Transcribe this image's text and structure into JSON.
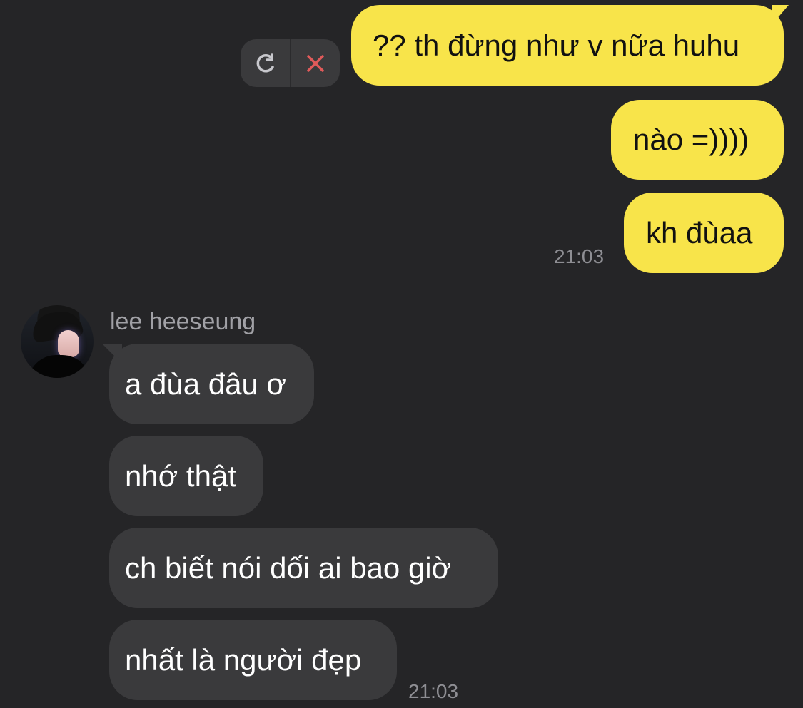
{
  "conversation": {
    "outgoing_messages": [
      {
        "text": "?? th đừng như v nữa huhu"
      },
      {
        "text": "nào =))))"
      },
      {
        "text": "kh đùaa"
      }
    ],
    "outgoing_timestamp": "21:03",
    "contact_name": "lee heeseung",
    "incoming_messages": [
      {
        "text": "a đùa đâu ơ"
      },
      {
        "text": "nhớ thật"
      },
      {
        "text": "ch biết nói dối ai bao giờ"
      },
      {
        "text": "nhất là người đẹp"
      }
    ],
    "incoming_timestamp": "21:03"
  },
  "icons": {
    "retry": "refresh-icon",
    "delete": "close-icon",
    "avatar": "profile-photo"
  },
  "colors": {
    "background": "#252527",
    "outgoing_bubble": "#f8e44a",
    "incoming_bubble": "#3a3a3c",
    "delete_icon": "#e05a5a"
  }
}
